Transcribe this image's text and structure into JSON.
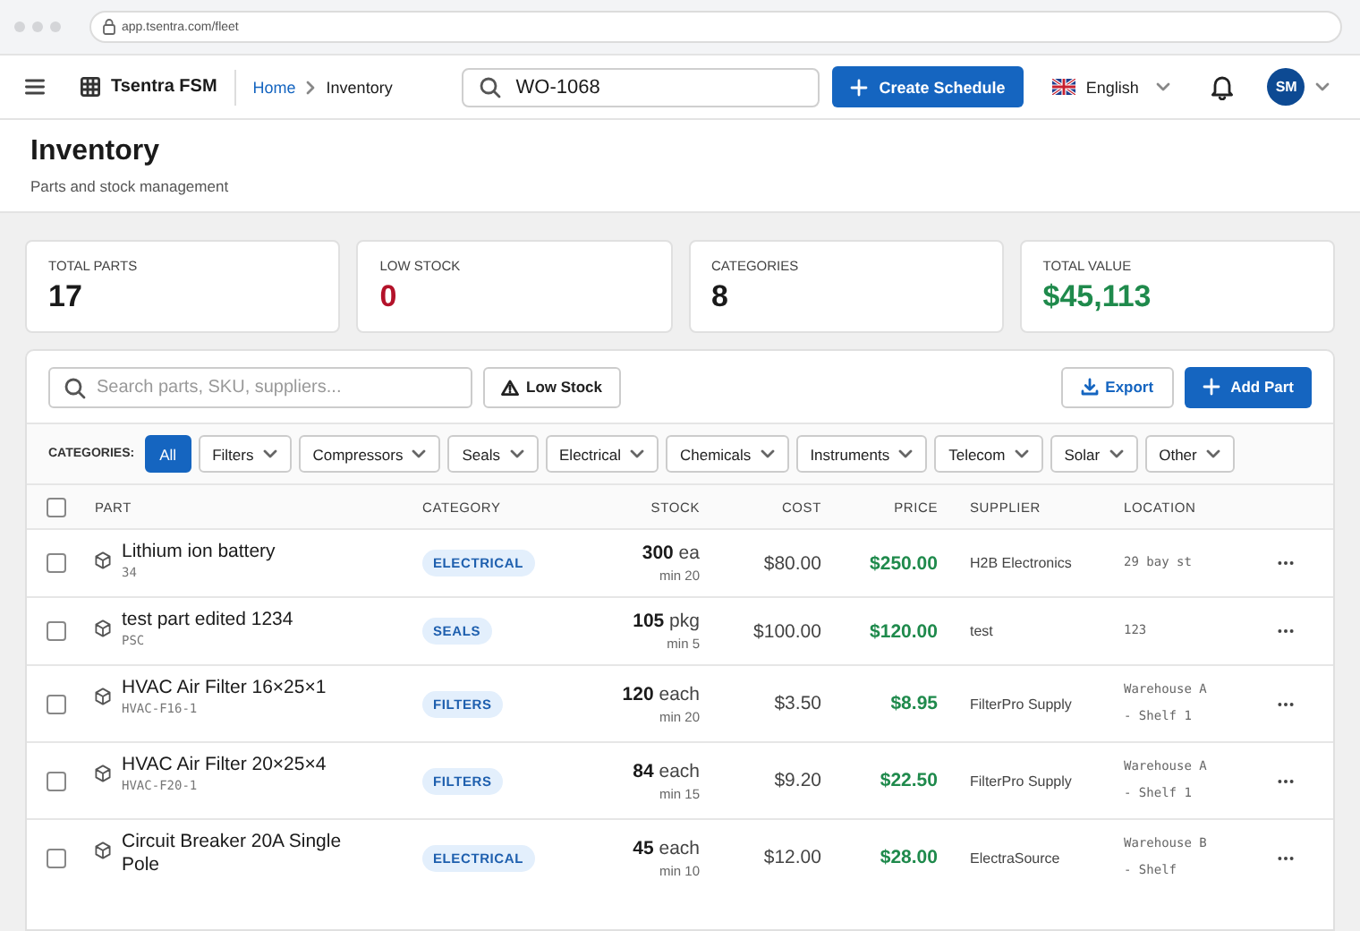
{
  "browser": {
    "url": "app.tsentra.com/fleet"
  },
  "header": {
    "brand": "Tsentra FSM",
    "breadcrumb": [
      "Home",
      "Inventory"
    ],
    "search_value": "WO-1068",
    "create_button": "Create Schedule",
    "language": "English",
    "avatar": "SM"
  },
  "page": {
    "title": "Inventory",
    "subtitle": "Parts and stock management"
  },
  "stats": [
    {
      "label": "TOTAL PARTS",
      "value": "17",
      "color": "#1a1a1a"
    },
    {
      "label": "LOW STOCK",
      "value": "0",
      "color": "#b3122a"
    },
    {
      "label": "CATEGORIES",
      "value": "8",
      "color": "#1a1a1a"
    },
    {
      "label": "TOTAL VALUE",
      "value": "$45,113",
      "color": "#1f8a4c"
    }
  ],
  "toolbar": {
    "search_placeholder": "Search parts, SKU, suppliers...",
    "low_stock_button": "Low Stock",
    "export_button": "Export",
    "add_button": "Add Part"
  },
  "categories": {
    "label": "CATEGORIES:",
    "chips": [
      {
        "label": "All",
        "selected": true,
        "dropdown": false
      },
      {
        "label": "Filters",
        "selected": false,
        "dropdown": true
      },
      {
        "label": "Compressors",
        "selected": false,
        "dropdown": true
      },
      {
        "label": "Seals",
        "selected": false,
        "dropdown": true
      },
      {
        "label": "Electrical",
        "selected": false,
        "dropdown": true
      },
      {
        "label": "Chemicals",
        "selected": false,
        "dropdown": true
      },
      {
        "label": "Instruments",
        "selected": false,
        "dropdown": true
      },
      {
        "label": "Telecom",
        "selected": false,
        "dropdown": true
      },
      {
        "label": "Solar",
        "selected": false,
        "dropdown": true
      },
      {
        "label": "Other",
        "selected": false,
        "dropdown": true
      }
    ]
  },
  "table": {
    "select_all_checked": false,
    "columns": [
      "PART",
      "CATEGORY",
      "STOCK",
      "COST",
      "PRICE",
      "SUPPLIER",
      "LOCATION"
    ],
    "rows": [
      {
        "checked": false,
        "name": "Lithium ion battery",
        "sku": "34",
        "category": "ELECTRICAL",
        "stock": "300",
        "unit": "ea",
        "min": "min 20",
        "cost": "$80.00",
        "price": "$250.00",
        "supplier": "H2B Electronics",
        "location": "29 bay st"
      },
      {
        "checked": false,
        "name": "test part edited 1234",
        "sku": "PSC",
        "category": "SEALS",
        "stock": "105",
        "unit": "pkg",
        "min": "min 5",
        "cost": "$100.00",
        "price": "$120.00",
        "supplier": "test",
        "location": "123"
      },
      {
        "checked": false,
        "name": "HVAC Air Filter 16×25×1",
        "sku": "HVAC-F16-1",
        "category": "FILTERS",
        "stock": "120",
        "unit": "each",
        "min": "min 20",
        "cost": "$3.50",
        "price": "$8.95",
        "supplier": "FilterPro Supply",
        "location": "Warehouse A - Shelf 1"
      },
      {
        "checked": false,
        "name": "HVAC Air Filter 20×25×4",
        "sku": "HVAC-F20-1",
        "category": "FILTERS",
        "stock": "84",
        "unit": "each",
        "min": "min 15",
        "cost": "$9.20",
        "price": "$22.50",
        "supplier": "FilterPro Supply",
        "location": "Warehouse A - Shelf 1"
      },
      {
        "checked": false,
        "name": "Circuit Breaker 20A Single Pole",
        "category": "ELECTRICAL",
        "stock": "45",
        "unit": "each",
        "min": "min 10",
        "cost": "$12.00",
        "price": "$28.00",
        "supplier": "ElectraSource",
        "location": "Warehouse B - Shelf"
      }
    ]
  }
}
